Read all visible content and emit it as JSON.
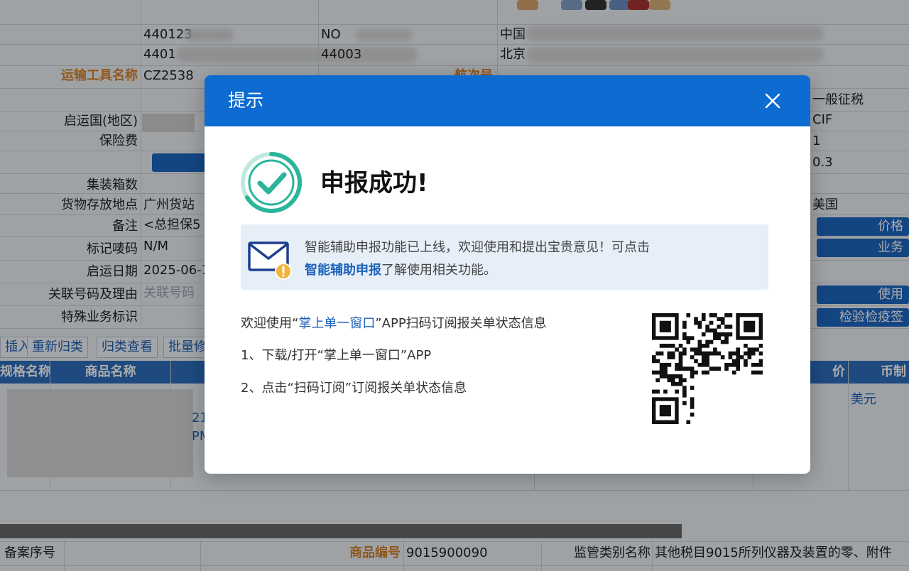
{
  "form": {
    "transport_label": "运输工具名称",
    "transport_value": "CZ2538",
    "voyage_label": "航次号",
    "row1_code": "440123",
    "row1_no": "NO",
    "row1_place": "中国",
    "row2_code": "4401",
    "row2_code2": "44003",
    "row2_place": "北京",
    "origin_country_label": "启运国(地区)",
    "insurance_label": "保险费",
    "container_label": "集装箱数",
    "storage_label": "货物存放地点",
    "storage_value": "广州货站",
    "remark_label": "备注",
    "remark_value": "<总担保5",
    "marks_label": "标记唛码",
    "marks_value": "N/M",
    "departure_date_label": "启运日期",
    "departure_date_value": "2025-06-1",
    "related_no_label": "关联号码及理由",
    "related_no_placeholder": "关联号码",
    "special_biz_label": "特殊业务标识",
    "right_tax": "一般征税",
    "right_terms": "CIF",
    "right_one": "1",
    "right_rate": "0.3",
    "right_country": "美国",
    "btn_price": "价格",
    "btn_business": "业务",
    "btn_use": "使用",
    "btn_inspection": "检验检疫签"
  },
  "toolbar": {
    "insert": "插入",
    "reclassify": "重新归类",
    "view_class": "归类查看",
    "batch": "批量修"
  },
  "table": {
    "col_name": "规格名称",
    "col_goods_name": "商品名称",
    "col_price": "价",
    "col_currency": "币制",
    "cell_currency": "美元",
    "frag1": "21",
    "frag2": "PM"
  },
  "bottom": {
    "record_no_label": "备案序号",
    "goods_code_label": "商品编号",
    "goods_code_value": "9015900090",
    "supervision_label": "监管类别名称",
    "supervision_value": "其他税目9015所列仪器及装置的零、附件"
  },
  "modal": {
    "title": "提示",
    "success_text": "申报成功!",
    "notice_line1": "智能辅助申报功能已上线，欢迎使用和提出宝贵意见！可点击",
    "notice_link": "智能辅助申报",
    "notice_line2_rest": "了解使用相关功能。",
    "info1_prefix": "欢迎使用“",
    "info1_app": "掌上单一窗口",
    "info1_suffix": "”APP扫码订阅报关单状态信息",
    "info2": "1、下载/打开“掌上单一窗口”APP",
    "info3": "2、点击“扫码订阅”订阅报关单状态信息"
  },
  "colors": {
    "header_blue": "#0d6bd1",
    "success_green": "#2bb59a",
    "link_blue": "#1d62b8",
    "label_orange": "#d9822b"
  },
  "icons": [
    "close-icon",
    "check-circle-icon",
    "mail-icon",
    "qr-code"
  ]
}
